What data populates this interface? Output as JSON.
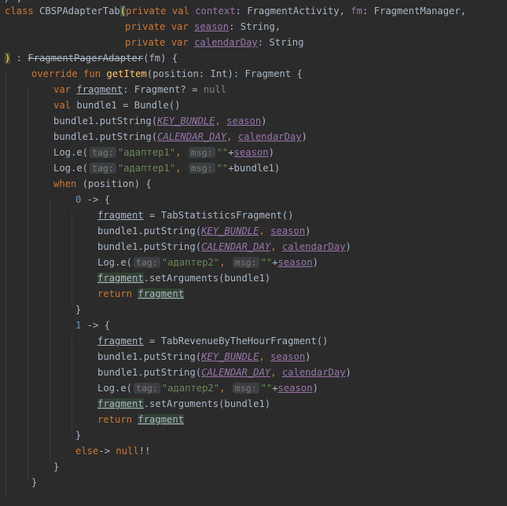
{
  "top_fragment": "/ ,",
  "lines": [
    {
      "indent": 0,
      "tokens": [
        {
          "t": "kw",
          "v": "class "
        },
        {
          "t": "txt",
          "v": "CBSPAdapterTab"
        },
        {
          "t": "paren-hl",
          "v": "("
        },
        {
          "t": "kw",
          "v": "private val "
        },
        {
          "t": "prop",
          "v": "context"
        },
        {
          "t": "txt",
          "v": ": FragmentActivity, "
        },
        {
          "t": "prop",
          "v": "fm"
        },
        {
          "t": "txt",
          "v": ": FragmentManager,"
        }
      ]
    },
    {
      "indent": 153,
      "tokens": [
        {
          "t": "kw",
          "v": "private var "
        },
        {
          "t": "propu",
          "v": "season"
        },
        {
          "t": "txt",
          "v": ": String,"
        }
      ]
    },
    {
      "indent": 153,
      "tokens": [
        {
          "t": "kw",
          "v": "private var "
        },
        {
          "t": "propu",
          "v": "calendarDay"
        },
        {
          "t": "txt",
          "v": ": String"
        }
      ]
    },
    {
      "indent": 0,
      "tokens": [
        {
          "t": "paren-y",
          "v": ")"
        },
        {
          "t": "txt",
          "v": " : "
        },
        {
          "t": "strike",
          "v": "FragmentPagerAdapter"
        },
        {
          "t": "txt",
          "v": "(fm) {"
        }
      ]
    },
    {
      "indent": 34,
      "tokens": [
        {
          "t": "kw",
          "v": "override fun "
        },
        {
          "t": "fn",
          "v": "getItem"
        },
        {
          "t": "txt",
          "v": "(position: Int): Fragment {"
        }
      ]
    },
    {
      "indent": 62,
      "tokens": [
        {
          "t": "kw",
          "v": "var "
        },
        {
          "t": "varu",
          "v": "fragment"
        },
        {
          "t": "txt",
          "v": ": Fragment? = "
        },
        {
          "t": "gnull",
          "v": "null"
        }
      ]
    },
    {
      "indent": 62,
      "tokens": [
        {
          "t": "kw",
          "v": "val "
        },
        {
          "t": "txt",
          "v": "bundle1 = Bundle()"
        }
      ]
    },
    {
      "indent": 62,
      "tokens": [
        {
          "t": "txt",
          "v": "bundle1.putString("
        },
        {
          "t": "pconst",
          "v": "KEY_BUNDLE"
        },
        {
          "t": "kw",
          "v": ", "
        },
        {
          "t": "propu",
          "v": "season"
        },
        {
          "t": "txt",
          "v": ")"
        }
      ]
    },
    {
      "indent": 62,
      "tokens": [
        {
          "t": "txt",
          "v": "bundle1.putString("
        },
        {
          "t": "pconst",
          "v": "CALENDAR_DAY"
        },
        {
          "t": "kw",
          "v": ", "
        },
        {
          "t": "propu",
          "v": "calendarDay"
        },
        {
          "t": "txt",
          "v": ")"
        }
      ]
    },
    {
      "indent": 62,
      "tokens": [
        {
          "t": "txt",
          "v": "Log.e("
        },
        {
          "t": "hint",
          "v": "tag:"
        },
        {
          "t": "str",
          "v": "\"адаптер1\""
        },
        {
          "t": "kw",
          "v": ", "
        },
        {
          "t": "hint",
          "v": "msg:"
        },
        {
          "t": "str",
          "v": "\"\""
        },
        {
          "t": "txt",
          "v": "+"
        },
        {
          "t": "propu",
          "v": "season"
        },
        {
          "t": "txt",
          "v": ")"
        }
      ]
    },
    {
      "indent": 62,
      "tokens": [
        {
          "t": "txt",
          "v": "Log.e("
        },
        {
          "t": "hint",
          "v": "tag:"
        },
        {
          "t": "str",
          "v": "\"адаптер1\""
        },
        {
          "t": "kw",
          "v": ", "
        },
        {
          "t": "hint",
          "v": "msg:"
        },
        {
          "t": "str",
          "v": "\"\""
        },
        {
          "t": "txt",
          "v": "+bundle1)"
        }
      ]
    },
    {
      "indent": 62,
      "tokens": [
        {
          "t": "kw",
          "v": "when "
        },
        {
          "t": "txt",
          "v": "(position) {"
        }
      ]
    },
    {
      "indent": 90,
      "tokens": [
        {
          "t": "num",
          "v": "0"
        },
        {
          "t": "txt",
          "v": " -> {"
        }
      ]
    },
    {
      "indent": 118,
      "tokens": [
        {
          "t": "varu",
          "v": "fragment"
        },
        {
          "t": "txt",
          "v": " = TabStatisticsFragment()"
        }
      ]
    },
    {
      "indent": 118,
      "tokens": [
        {
          "t": "txt",
          "v": "bundle1.putString("
        },
        {
          "t": "pconst",
          "v": "KEY_BUNDLE"
        },
        {
          "t": "kw",
          "v": ", "
        },
        {
          "t": "propu",
          "v": "season"
        },
        {
          "t": "txt",
          "v": ")"
        }
      ]
    },
    {
      "indent": 118,
      "tokens": [
        {
          "t": "txt",
          "v": "bundle1.putString("
        },
        {
          "t": "pconst",
          "v": "CALENDAR_DAY"
        },
        {
          "t": "kw",
          "v": ", "
        },
        {
          "t": "propu",
          "v": "calendarDay"
        },
        {
          "t": "txt",
          "v": ")"
        }
      ]
    },
    {
      "indent": 118,
      "tokens": [
        {
          "t": "txt",
          "v": "Log.e("
        },
        {
          "t": "hint",
          "v": "tag:"
        },
        {
          "t": "str",
          "v": "\"адаптер2\""
        },
        {
          "t": "kw",
          "v": ", "
        },
        {
          "t": "hint",
          "v": "msg:"
        },
        {
          "t": "str",
          "v": "\"\""
        },
        {
          "t": "txt",
          "v": "+"
        },
        {
          "t": "propu",
          "v": "season"
        },
        {
          "t": "txt",
          "v": ")"
        }
      ]
    },
    {
      "indent": 118,
      "tokens": [
        {
          "t": "smartcast",
          "v": "fragment"
        },
        {
          "t": "txt",
          "v": ".setArguments(bundle1)"
        }
      ]
    },
    {
      "indent": 118,
      "tokens": [
        {
          "t": "kw",
          "v": "return "
        },
        {
          "t": "smartcast",
          "v": "fragment"
        }
      ]
    },
    {
      "indent": 90,
      "tokens": [
        {
          "t": "txt",
          "v": "}"
        }
      ]
    },
    {
      "indent": 90,
      "tokens": [
        {
          "t": "num",
          "v": "1"
        },
        {
          "t": "txt",
          "v": " -> {"
        }
      ]
    },
    {
      "indent": 118,
      "tokens": [
        {
          "t": "varu",
          "v": "fragment"
        },
        {
          "t": "txt",
          "v": " = TabRevenueByTheHourFragment()"
        }
      ]
    },
    {
      "indent": 118,
      "tokens": [
        {
          "t": "txt",
          "v": "bundle1.putString("
        },
        {
          "t": "pconst",
          "v": "KEY_BUNDLE"
        },
        {
          "t": "kw",
          "v": ", "
        },
        {
          "t": "propu",
          "v": "season"
        },
        {
          "t": "txt",
          "v": ")"
        }
      ]
    },
    {
      "indent": 118,
      "tokens": [
        {
          "t": "txt",
          "v": "bundle1.putString("
        },
        {
          "t": "pconst",
          "v": "CALENDAR_DAY"
        },
        {
          "t": "kw",
          "v": ", "
        },
        {
          "t": "propu",
          "v": "calendarDay"
        },
        {
          "t": "txt",
          "v": ")"
        }
      ]
    },
    {
      "indent": 118,
      "tokens": [
        {
          "t": "txt",
          "v": "Log.e("
        },
        {
          "t": "hint",
          "v": "tag:"
        },
        {
          "t": "str",
          "v": "\"адаптер2\""
        },
        {
          "t": "kw",
          "v": ", "
        },
        {
          "t": "hint",
          "v": "msg:"
        },
        {
          "t": "str",
          "v": "\"\""
        },
        {
          "t": "txt",
          "v": "+"
        },
        {
          "t": "propu",
          "v": "season"
        },
        {
          "t": "txt",
          "v": ")"
        }
      ]
    },
    {
      "indent": 118,
      "tokens": [
        {
          "t": "smartcast",
          "v": "fragment"
        },
        {
          "t": "txt",
          "v": ".setArguments(bundle1)"
        }
      ]
    },
    {
      "indent": 118,
      "tokens": [
        {
          "t": "kw",
          "v": "return "
        },
        {
          "t": "smartcast",
          "v": "fragment"
        }
      ]
    },
    {
      "indent": 90,
      "tokens": [
        {
          "t": "txt",
          "v": "}"
        }
      ]
    },
    {
      "indent": 90,
      "tokens": [
        {
          "t": "kw",
          "v": "else"
        },
        {
          "t": "txt",
          "v": "-> "
        },
        {
          "t": "kw",
          "v": "null"
        },
        {
          "t": "txt",
          "v": "!!"
        }
      ]
    },
    {
      "indent": 62,
      "tokens": [
        {
          "t": "txt",
          "v": "}"
        }
      ]
    },
    {
      "indent": 34,
      "tokens": [
        {
          "t": "txt",
          "v": "}"
        }
      ]
    }
  ],
  "colors": {
    "background": "#2b2b2b",
    "keyword": "#cc7832",
    "property": "#9876aa",
    "string": "#6a8759",
    "number": "#6897bb",
    "function": "#ffc66d",
    "text": "#a9b7c6"
  }
}
